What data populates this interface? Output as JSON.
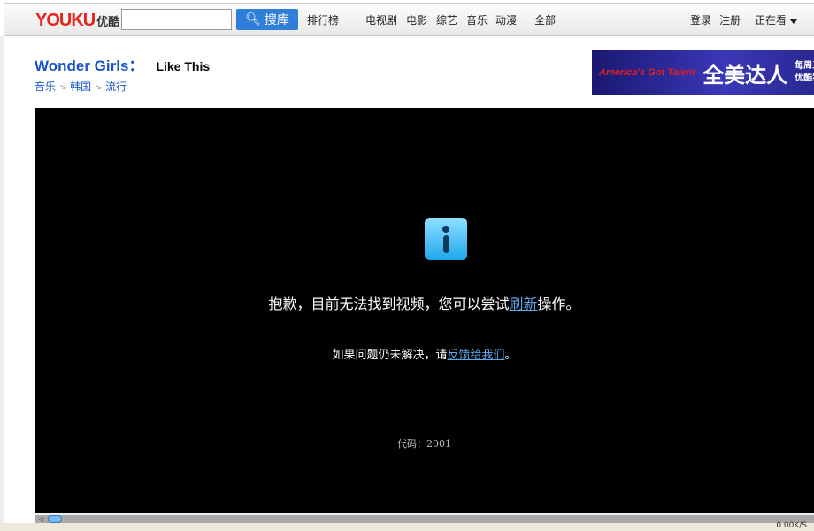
{
  "header": {
    "logo": "YOUKU",
    "logo_cn": "优酷",
    "search": {
      "value": "",
      "placeholder": ""
    },
    "search_button": "搜库",
    "nav": [
      "排行榜",
      "电视剧",
      "电影",
      "综艺",
      "音乐",
      "动漫",
      "全部"
    ],
    "login": "登录",
    "register": "注册",
    "watching": "正在看"
  },
  "video": {
    "artist": "Wonder Girls",
    "colon": "：",
    "title": "Like This",
    "breadcrumb": [
      "音乐",
      "韩国",
      "流行"
    ],
    "breadcrumb_sep": ">"
  },
  "ad": {
    "brand": "America's Got Talent",
    "title": "全美达人",
    "line1": "每周三 同",
    "line2": "优酷独家同"
  },
  "player": {
    "msg1_pre": "抱歉，目前无法找到视频，您可以尝试",
    "msg1_link": "刷新",
    "msg1_post": "操作。",
    "msg2_pre": "如果问题仍未解决，请",
    "msg2_link": "反馈给我们",
    "msg2_post": "。",
    "code": "代码：2001",
    "progress": 0
  },
  "status": {
    "speed": "0.00K/S"
  }
}
